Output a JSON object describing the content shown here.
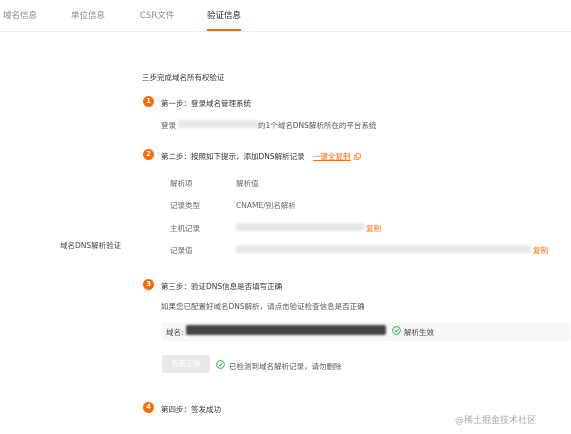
{
  "tabs": [
    {
      "label": "域名信息"
    },
    {
      "label": "单位信息"
    },
    {
      "label": "CSR文件"
    },
    {
      "label": "验证信息"
    }
  ],
  "active_tab": "验证信息",
  "side_label": "域名DNS解析验证",
  "heading": "三步完成域名所有权验证",
  "steps": [
    {
      "number": "1",
      "title": "第一步：登录域名管理系统",
      "text_prefix": "登录",
      "text_suffix": "的1个域名DNS解析所在的平台系统"
    },
    {
      "number": "2",
      "title": "第二步：按照如下提示，添加DNS解析记录",
      "action": "一键全复制"
    },
    {
      "number": "3",
      "title": "第三步：验证DNS信息是否填写正确",
      "text": "如果您已配置好域名DNS解析，请点击验证检查信息是否正确"
    },
    {
      "number": "4",
      "title": "第四步：签发成功"
    }
  ],
  "record_table": {
    "header_key": "解析项",
    "header_value": "解析值",
    "type_key": "记录类型",
    "type_value": "CNAME/别名解析",
    "host_key": "主机记录",
    "value_key": "记录值",
    "copy_label": "复制"
  },
  "verify": {
    "domain_label": "域名:",
    "status": "解析生效",
    "button_label": "配置正确",
    "result": "已检测到域名解析记录，请勿删除"
  },
  "watermark": "@稀土掘金技术社区",
  "colors": {
    "accent": "#ff6a00",
    "success": "#2fb344"
  },
  "icons": {
    "copy": "copy-icon",
    "check": "check-circle-icon"
  }
}
